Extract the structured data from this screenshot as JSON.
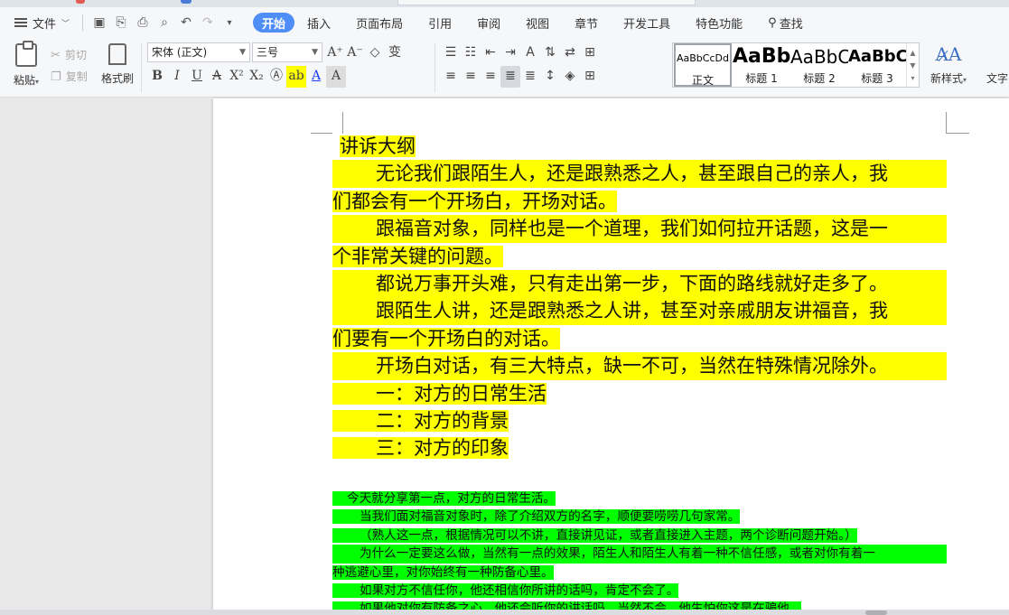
{
  "menubar": {
    "file_label": "文件",
    "tabs": [
      "开始",
      "插入",
      "页面布局",
      "引用",
      "审阅",
      "视图",
      "章节",
      "开发工具",
      "特色功能"
    ],
    "search_label": "查找"
  },
  "ribbon": {
    "paste_label": "粘贴",
    "cut_label": "剪切",
    "copy_label": "复制",
    "format_painter_label": "格式刷",
    "font_name": "宋体 (正文)",
    "font_size": "三号",
    "styles": [
      {
        "preview": "AaBbCcDd",
        "name": "正文"
      },
      {
        "preview": "AaBb",
        "name": "标题 1"
      },
      {
        "preview": "AaBbC",
        "name": "标题 2"
      },
      {
        "preview": "AaBbC",
        "name": "标题 3"
      }
    ],
    "new_style_label": "新样式",
    "text_tools_label": "文字"
  },
  "document": {
    "title": "讲诉大纲",
    "lines": [
      "无论我们跟陌生人，还是跟熟悉之人，甚至跟自己的亲人，我",
      "们都会有一个开场白，开场对话。",
      "跟福音对象，同样也是一个道理，我们如何拉开话题，这是一",
      "个非常关键的问题。",
      "都说万事开头难，只有走出第一步，下面的路线就好走多了。",
      "跟陌生人讲，还是跟熟悉之人讲，甚至对亲戚朋友讲福音，我",
      "们要有一个开场白的对话。",
      "开场白对话，有三大特点，缺一不可，当然在特殊情况除外。",
      "一：对方的日常生活",
      "二：对方的背景",
      "三：对方的印象"
    ],
    "green_lines": [
      "今天就分享第一点，对方的日常生活。",
      "当我们面对福音对象时，除了介绍双方的名字，顺便要唠唠几句家常。",
      "（熟人这一点，根据情况可以不讲，直接讲见证，或者直接进入主题，两个诊断问题开始。）",
      "为什么一定要这么做，当然有一点的效果，陌生人和陌生人有着一种不信任感，或者对你有着一",
      "种逃避心里，对你始终有一种防备心里。",
      "如果对方不信任你，他还相信你所讲的话吗，肯定不会了。",
      "如果他对你有防备之心，他还会听你的讲话吗，当然不会，他生怕你这是在骗他。"
    ]
  }
}
